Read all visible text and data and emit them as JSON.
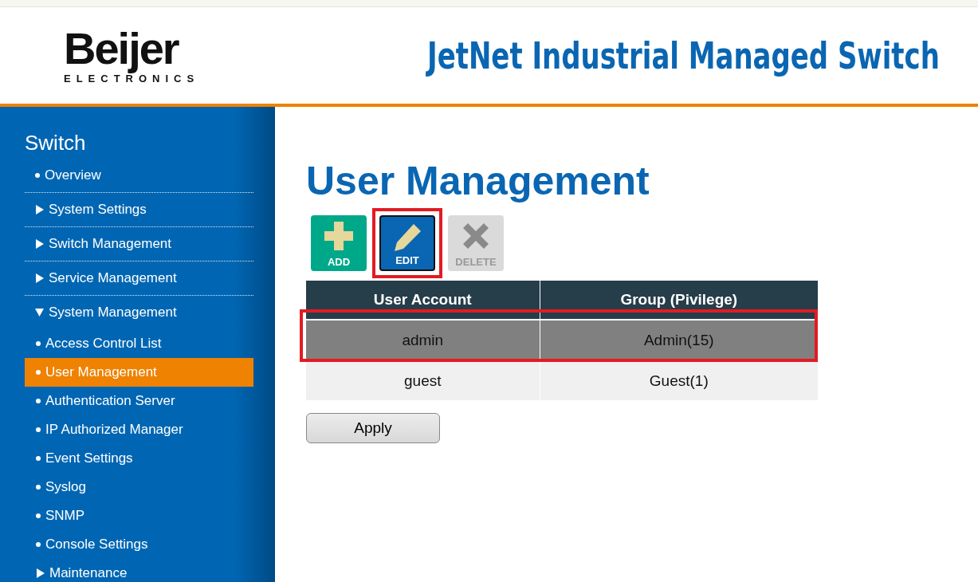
{
  "header": {
    "logo_name": "Beijer",
    "logo_sub": "ELECTRONICS",
    "title": "JetNet Industrial Managed Switch"
  },
  "sidebar": {
    "title": "Switch",
    "items": [
      {
        "label": "Overview",
        "kind": "leaf",
        "selected": false
      },
      {
        "label": "System Settings",
        "kind": "folder",
        "expanded": false,
        "selected": false
      },
      {
        "label": "Switch Management",
        "kind": "folder",
        "expanded": false,
        "selected": false
      },
      {
        "label": "Service Management",
        "kind": "folder",
        "expanded": false,
        "selected": false
      },
      {
        "label": "System Management",
        "kind": "folder",
        "expanded": true,
        "selected": false,
        "children": [
          {
            "label": "Access Control List",
            "kind": "leaf",
            "selected": false
          },
          {
            "label": "User Management",
            "kind": "leaf",
            "selected": true
          },
          {
            "label": "Authentication Server",
            "kind": "leaf",
            "selected": false
          },
          {
            "label": "IP Authorized Manager",
            "kind": "leaf",
            "selected": false
          },
          {
            "label": "Event Settings",
            "kind": "leaf",
            "selected": false
          },
          {
            "label": "Syslog",
            "kind": "leaf",
            "selected": false
          },
          {
            "label": "SNMP",
            "kind": "leaf",
            "selected": false
          },
          {
            "label": "Console Settings",
            "kind": "leaf",
            "selected": false
          },
          {
            "label": "Maintenance",
            "kind": "folder",
            "expanded": false,
            "selected": false
          }
        ]
      }
    ]
  },
  "page": {
    "title": "User Management",
    "toolbar": [
      {
        "kind": "add",
        "label": "ADD",
        "disabled": false,
        "highlighted": false
      },
      {
        "kind": "edit",
        "label": "EDIT",
        "disabled": false,
        "highlighted": true
      },
      {
        "kind": "delete",
        "label": "DELETE",
        "disabled": true,
        "highlighted": false
      }
    ],
    "table": {
      "columns": [
        "User Account",
        "Group (Pivilege)"
      ],
      "rows": [
        {
          "cells": [
            "admin",
            "Admin(15)"
          ],
          "selected": true,
          "highlighted": true
        },
        {
          "cells": [
            "guest",
            "Guest(1)"
          ],
          "selected": false,
          "highlighted": false
        }
      ]
    },
    "apply_button": "Apply"
  }
}
